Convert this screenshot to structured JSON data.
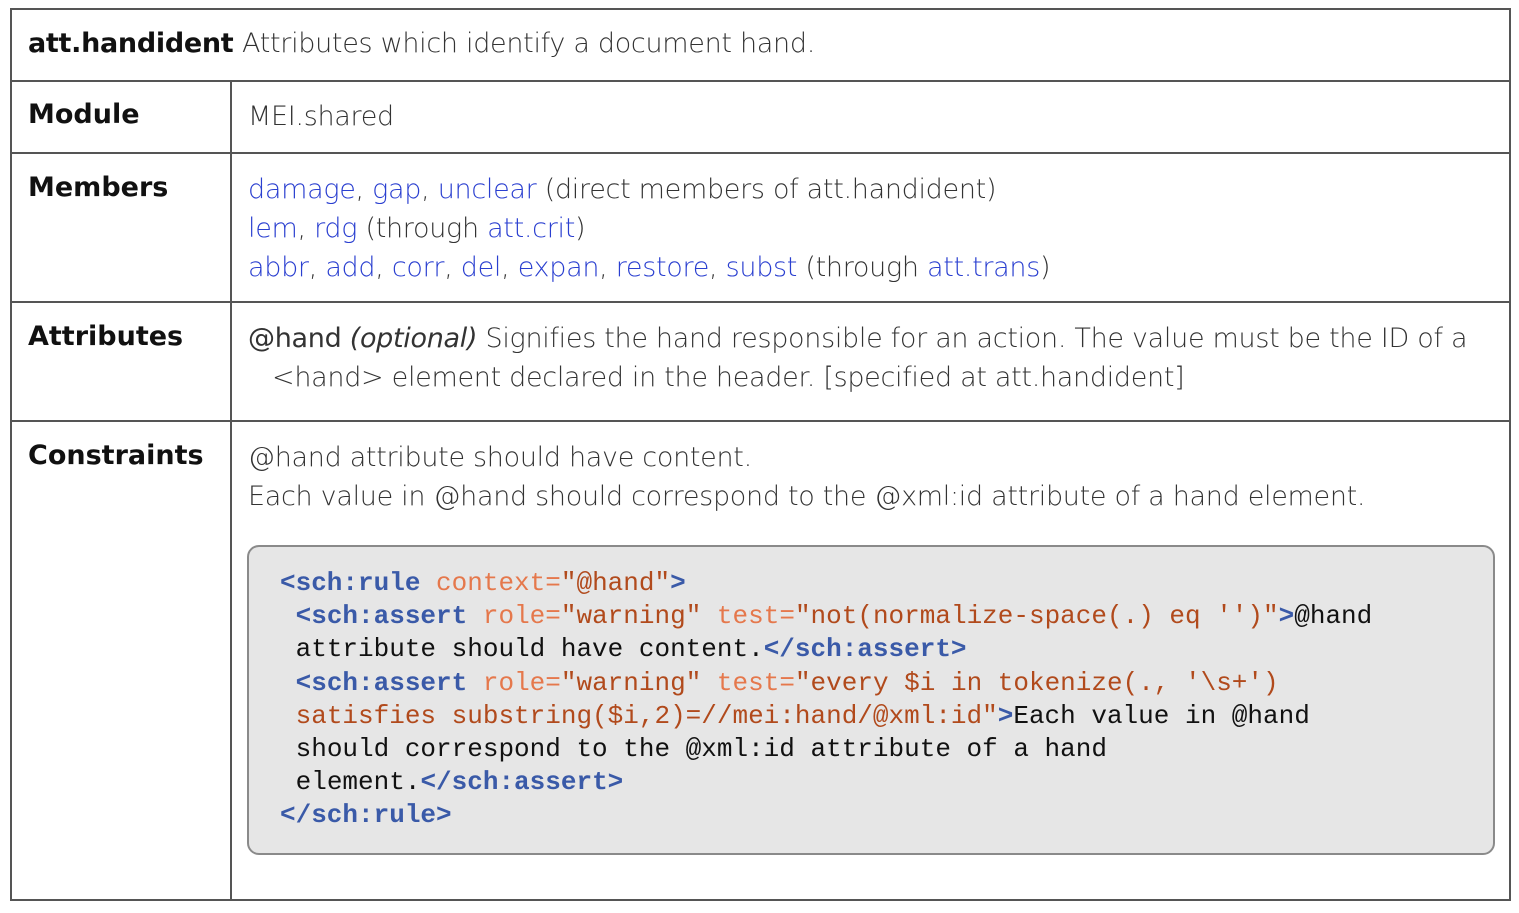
{
  "header": {
    "name": "att.handident",
    "description": "Attributes which identify a document hand."
  },
  "module": {
    "label": "Module",
    "value": "MEI.shared"
  },
  "members": {
    "label": "Members",
    "lines": [
      {
        "links": [
          "damage",
          "gap",
          "unclear"
        ],
        "note": "direct members of att.handident"
      },
      {
        "links": [
          "lem",
          "rdg"
        ],
        "via_prefix": "through",
        "via": "att.crit"
      },
      {
        "links": [
          "abbr",
          "add",
          "corr",
          "del",
          "expan",
          "restore",
          "subst"
        ],
        "via_prefix": "through",
        "via": "att.trans"
      }
    ]
  },
  "attributes": {
    "label": "Attributes",
    "name": "@hand",
    "optional": "(optional)",
    "desc_line1": "Signifies the hand responsible for an action. The value must be the ID of a",
    "desc_line2": "<hand> element declared in the header. [specified at att.handident]"
  },
  "constraints": {
    "label": "Constraints",
    "lines": [
      "@hand attribute should have content.",
      "Each value in @hand should correspond to the @xml:id attribute of a hand element."
    ],
    "code": {
      "rule_open": "<sch:rule",
      "rule_ctx_attr": "context=",
      "rule_ctx_val": "\"@hand\"",
      "gt": ">",
      "assert_open": "<sch:assert",
      "role_attr": "role=",
      "role_val": "\"warning\"",
      "test_attr": "test=",
      "test1": "\"not(normalize-space(.) eq '')\"",
      "msg1_a": "@hand",
      "msg1_b": "attribute should have content.",
      "assert_close": "</sch:assert>",
      "test2_a": "\"every $i in tokenize(., '\\s+')",
      "test2_b": "satisfies substring($i,2)=//mei:hand/@xml:id\"",
      "msg2_a": "Each value in @hand",
      "msg2_b": "should correspond to the @xml:id attribute of a hand",
      "msg2_c": "element.",
      "rule_close": "</sch:rule>"
    }
  },
  "colors": {
    "link": "#2a3fd0",
    "code_tag": "#3a5aa8",
    "code_attr": "#e5784c",
    "code_str": "#b14a1c",
    "code_bg": "#e6e6e6"
  }
}
